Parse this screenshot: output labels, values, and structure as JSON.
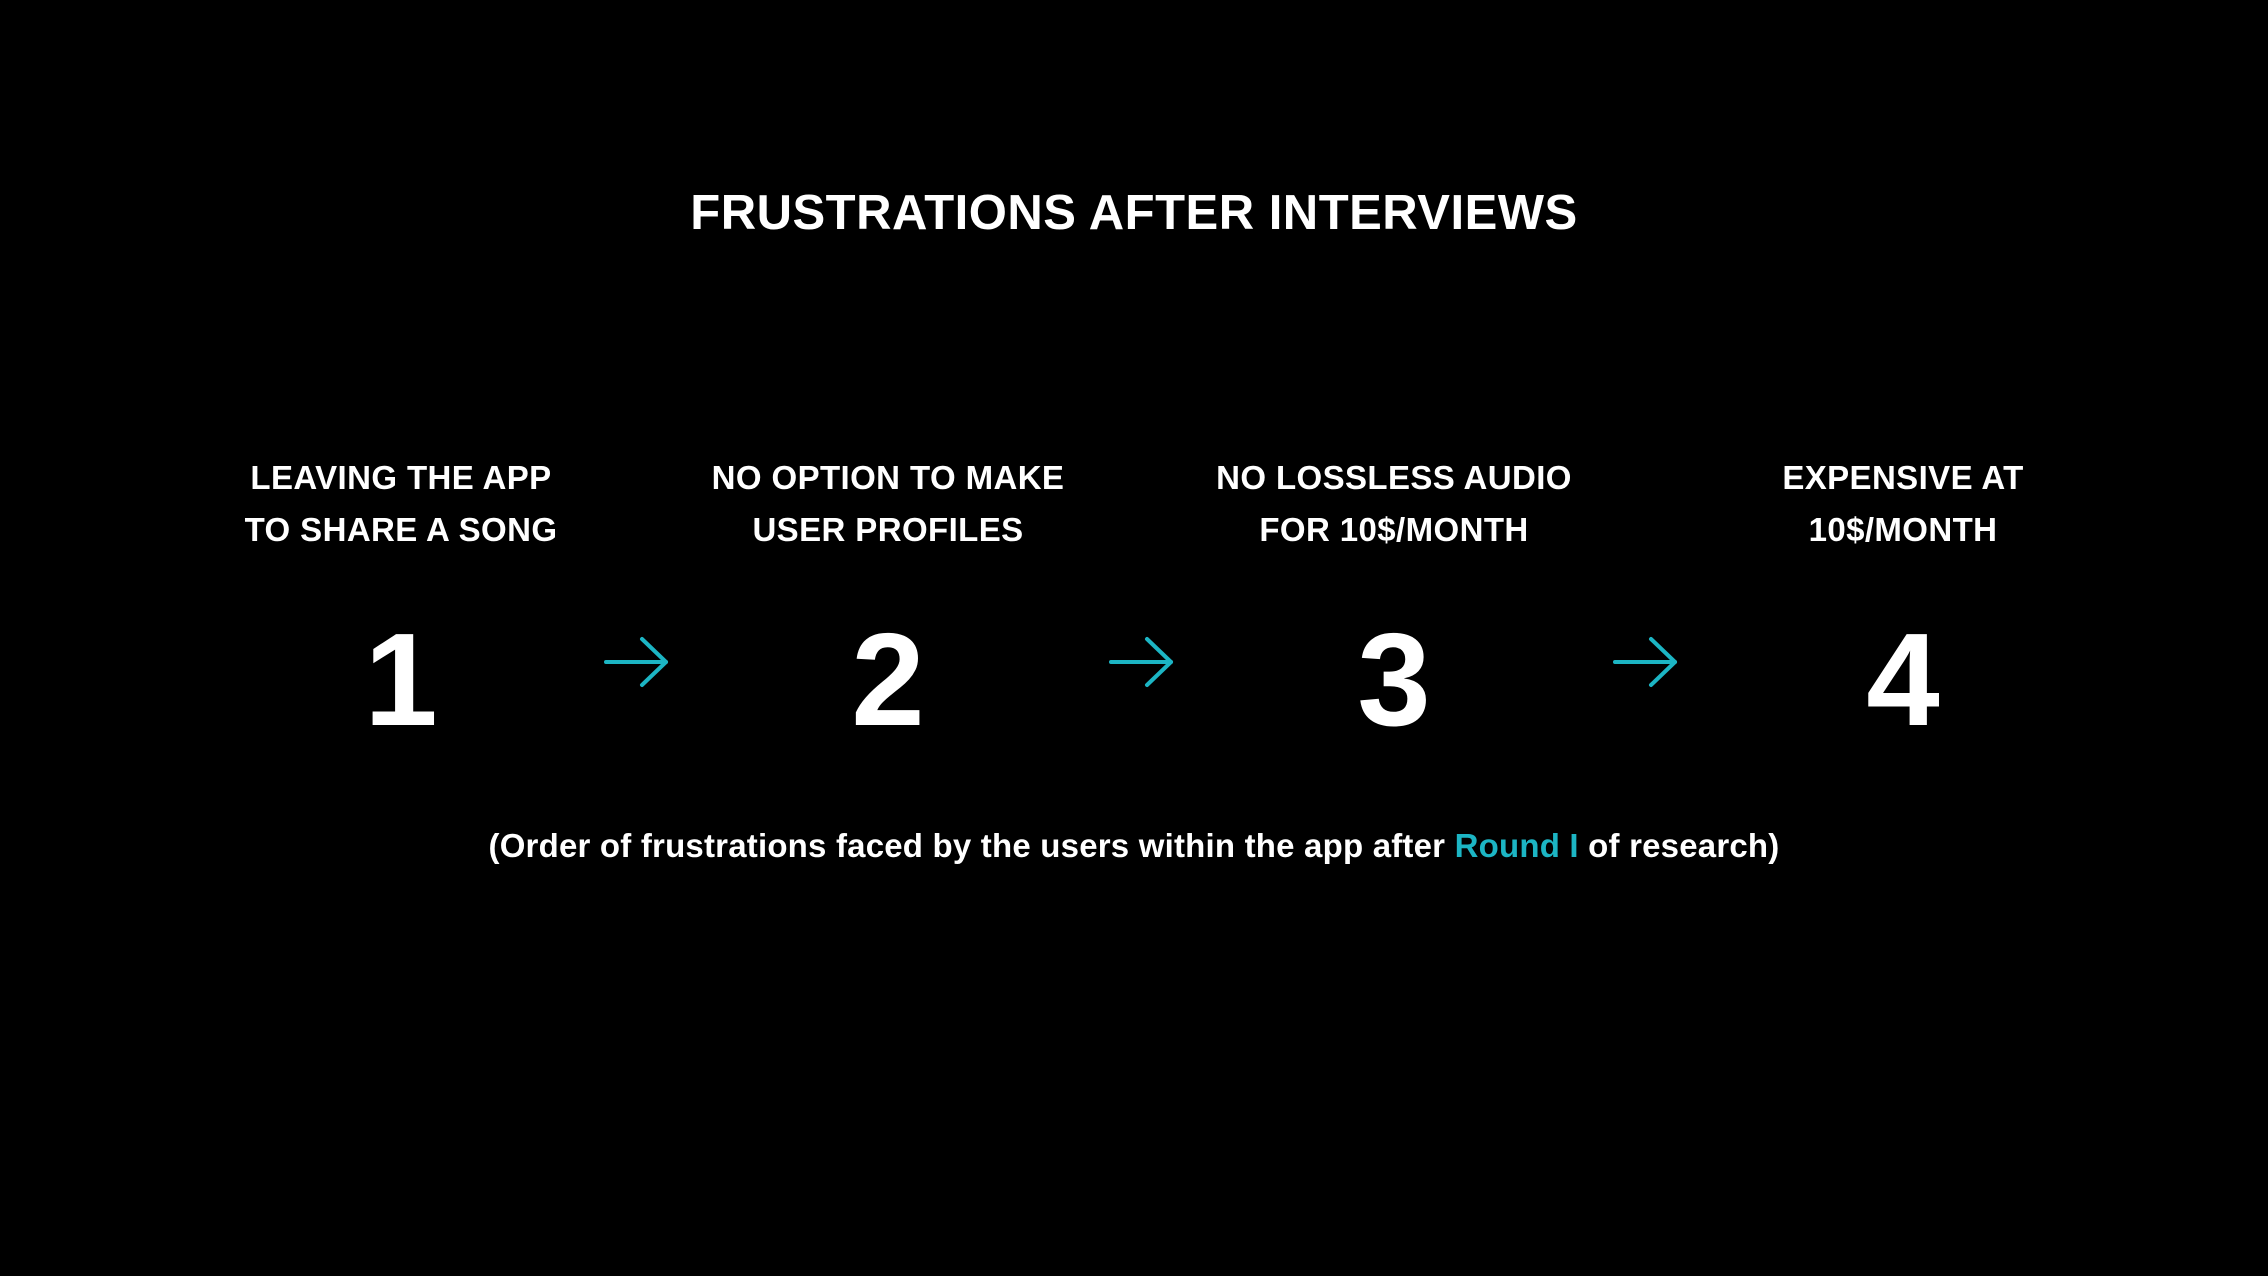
{
  "title": "FRUSTRATIONS AFTER INTERVIEWS",
  "colors": {
    "background": "#000000",
    "text": "#ffffff",
    "accent": "#1cb5c4"
  },
  "steps": [
    {
      "label": "LEAVING THE APP\nTO SHARE A SONG",
      "number": "1"
    },
    {
      "label": "NO OPTION TO MAKE\nUSER PROFILES",
      "number": "2"
    },
    {
      "label": "NO LOSSLESS AUDIO\nFOR 10$/MONTH",
      "number": "3"
    },
    {
      "label": "EXPENSIVE AT\n10$/MONTH",
      "number": "4"
    }
  ],
  "arrow_icon": "arrow-right-icon",
  "caption": {
    "before": "(Order of frustrations faced by the users within the app after ",
    "highlight": "Round I",
    "after": " of research)"
  }
}
